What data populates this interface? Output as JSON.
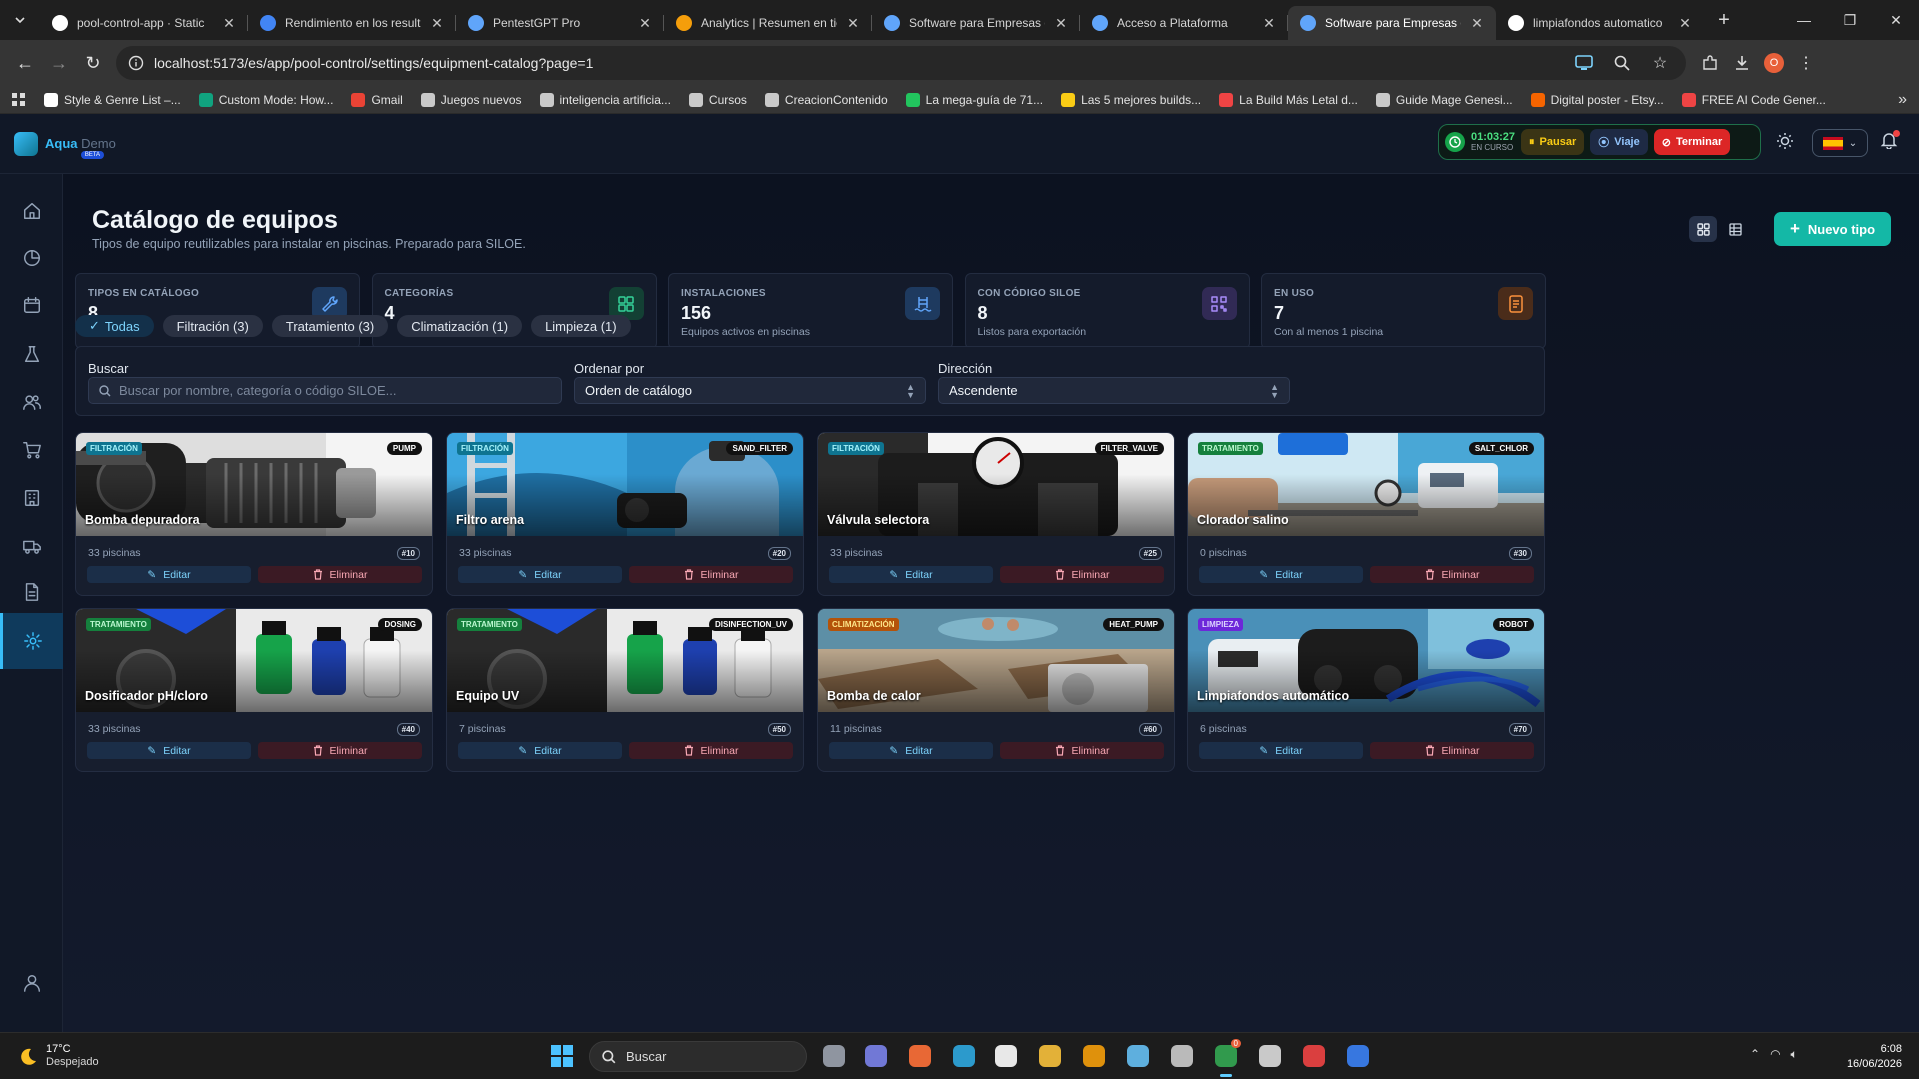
{
  "browser": {
    "tabs": [
      {
        "title": "pool-control-app · Static",
        "favicon_color": "#ffffff",
        "active": false
      },
      {
        "title": "Rendimiento en los result",
        "favicon_color": "#4285f4",
        "active": false
      },
      {
        "title": "PentestGPT Pro",
        "favicon_color": "#60a5fa",
        "active": false
      },
      {
        "title": "Analytics | Resumen en tie",
        "favicon_color": "#f59e0b",
        "active": false
      },
      {
        "title": "Software para Empresas d",
        "favicon_color": "#60a5fa",
        "active": false
      },
      {
        "title": "Acceso a Plataforma",
        "favicon_color": "#60a5fa",
        "active": false
      },
      {
        "title": "Software para Empresas d",
        "favicon_color": "#60a5fa",
        "active": true
      },
      {
        "title": "limpiafondos automatico",
        "favicon_color": "#ffffff",
        "active": false
      }
    ],
    "url": "localhost:5173/es/app/pool-control/settings/equipment-catalog?page=1",
    "profile_initial": "O",
    "bookmarks": [
      {
        "label": "Style & Genre List –...",
        "color": "#ffffff"
      },
      {
        "label": "Custom Mode: How...",
        "color": "#10a37f"
      },
      {
        "label": "Gmail",
        "color": "#ea4335"
      },
      {
        "label": "Juegos nuevos",
        "color": "#c9c9c9"
      },
      {
        "label": "inteligencia artificia...",
        "color": "#c9c9c9"
      },
      {
        "label": "Cursos",
        "color": "#c9c9c9"
      },
      {
        "label": "CreacionContenido",
        "color": "#c9c9c9"
      },
      {
        "label": "La mega-guía de 71...",
        "color": "#22c55e"
      },
      {
        "label": "Las 5 mejores builds...",
        "color": "#facc15"
      },
      {
        "label": "La Build Más Letal d...",
        "color": "#ef4444"
      },
      {
        "label": "Guide Mage Genesi...",
        "color": "#c9c9c9"
      },
      {
        "label": "Digital poster - Etsy...",
        "color": "#f56400"
      },
      {
        "label": "FREE AI Code Gener...",
        "color": "#ef4444"
      }
    ]
  },
  "header": {
    "logo_name": "Aqua",
    "logo_suffix": "Demo",
    "logo_badge": "BETA",
    "timer": "01:03:27",
    "timer_state": "EN CURSO",
    "pause_label": "Pausar",
    "trip_label": "Viaje",
    "end_label": "Terminar"
  },
  "sidebar": [
    "home-icon",
    "chart-pie-icon",
    "calendar-icon",
    "flask-icon",
    "users-icon",
    "cart-icon",
    "building-icon",
    "truck-icon",
    "document-icon",
    "gear-icon",
    "user-icon"
  ],
  "page": {
    "title": "Catálogo de equipos",
    "subtitle": "Tipos de equipo reutilizables para instalar en piscinas. Preparado para SILOE.",
    "new_button": "Nuevo tipo"
  },
  "stats": [
    {
      "label": "TIPOS EN CATÁLOGO",
      "value": "8",
      "note": "",
      "icon": "wrench-icon",
      "color": "#60a5fa"
    },
    {
      "label": "CATEGORÍAS",
      "value": "4",
      "note": "",
      "icon": "grid-icon",
      "color": "#34d399"
    },
    {
      "label": "INSTALACIONES",
      "value": "156",
      "note": "Equipos activos en piscinas",
      "icon": "pool-icon",
      "color": "#60a5fa"
    },
    {
      "label": "CON CÓDIGO SILOE",
      "value": "8",
      "note": "Listos para exportación",
      "icon": "qr-icon",
      "color": "#a78bfa"
    },
    {
      "label": "EN USO",
      "value": "7",
      "note": "Con al menos 1 piscina",
      "icon": "list-icon",
      "color": "#fb923c"
    }
  ],
  "filters": [
    {
      "label": "Todas",
      "active": true
    },
    {
      "label": "Filtración (3)",
      "active": false
    },
    {
      "label": "Tratamiento (3)",
      "active": false
    },
    {
      "label": "Climatización (1)",
      "active": false
    },
    {
      "label": "Limpieza (1)",
      "active": false
    }
  ],
  "search": {
    "label": "Buscar",
    "placeholder": "Buscar por nombre, categoría o código SILOE...",
    "sort_label": "Ordenar por",
    "sort_value": "Orden de catálogo",
    "dir_label": "Dirección",
    "dir_value": "Ascendente"
  },
  "cards": [
    {
      "name": "Bomba depuradora",
      "category": "FILTRACIÓN",
      "code": "PUMP",
      "pools": "33 piscinas",
      "order": "#10",
      "edit": "Editar",
      "delete": "Eliminar",
      "scene": "pump"
    },
    {
      "name": "Filtro arena",
      "category": "FILTRACIÓN",
      "code": "SAND_FILTER",
      "pools": "33 piscinas",
      "order": "#20",
      "edit": "Editar",
      "delete": "Eliminar",
      "scene": "filter"
    },
    {
      "name": "Válvula selectora",
      "category": "FILTRACIÓN",
      "code": "FILTER_VALVE",
      "pools": "33 piscinas",
      "order": "#25",
      "edit": "Editar",
      "delete": "Eliminar",
      "scene": "valve"
    },
    {
      "name": "Clorador salino",
      "category": "TRATAMIENTO",
      "code": "SALT_CHLOR",
      "pools": "0 piscinas",
      "order": "#30",
      "edit": "Editar",
      "delete": "Eliminar",
      "scene": "chlor"
    },
    {
      "name": "Dosificador pH/cloro",
      "category": "TRATAMIENTO",
      "code": "DOSING",
      "pools": "33 piscinas",
      "order": "#40",
      "edit": "Editar",
      "delete": "Eliminar",
      "scene": "dosing"
    },
    {
      "name": "Equipo UV",
      "category": "TRATAMIENTO",
      "code": "DISINFECTION_UV",
      "pools": "7 piscinas",
      "order": "#50",
      "edit": "Editar",
      "delete": "Eliminar",
      "scene": "dosing"
    },
    {
      "name": "Bomba de calor",
      "category": "CLIMATIZACIÓN",
      "code": "HEAT_PUMP",
      "pools": "11 piscinas",
      "order": "#60",
      "edit": "Editar",
      "delete": "Eliminar",
      "scene": "heat"
    },
    {
      "name": "Limpiafondos automático",
      "category": "LIMPIEZA",
      "code": "ROBOT",
      "pools": "6 piscinas",
      "order": "#70",
      "edit": "Editar",
      "delete": "Eliminar",
      "scene": "robot"
    }
  ],
  "category_colors": {
    "FILTRACIÓN": {
      "bg": "#0e7490",
      "fg": "#a5f3fc"
    },
    "TRATAMIENTO": {
      "bg": "#15803d",
      "fg": "#bbf7d0"
    },
    "CLIMATIZACIÓN": {
      "bg": "#b45309",
      "fg": "#fde68a"
    },
    "LIMPIEZA": {
      "bg": "#6d28d9",
      "fg": "#ddd6fe"
    }
  },
  "taskbar": {
    "temp": "17°C",
    "weather": "Despejado",
    "search": "Buscar",
    "time": "6:08",
    "date": "16/06/2026",
    "chrome_badge": "0"
  }
}
